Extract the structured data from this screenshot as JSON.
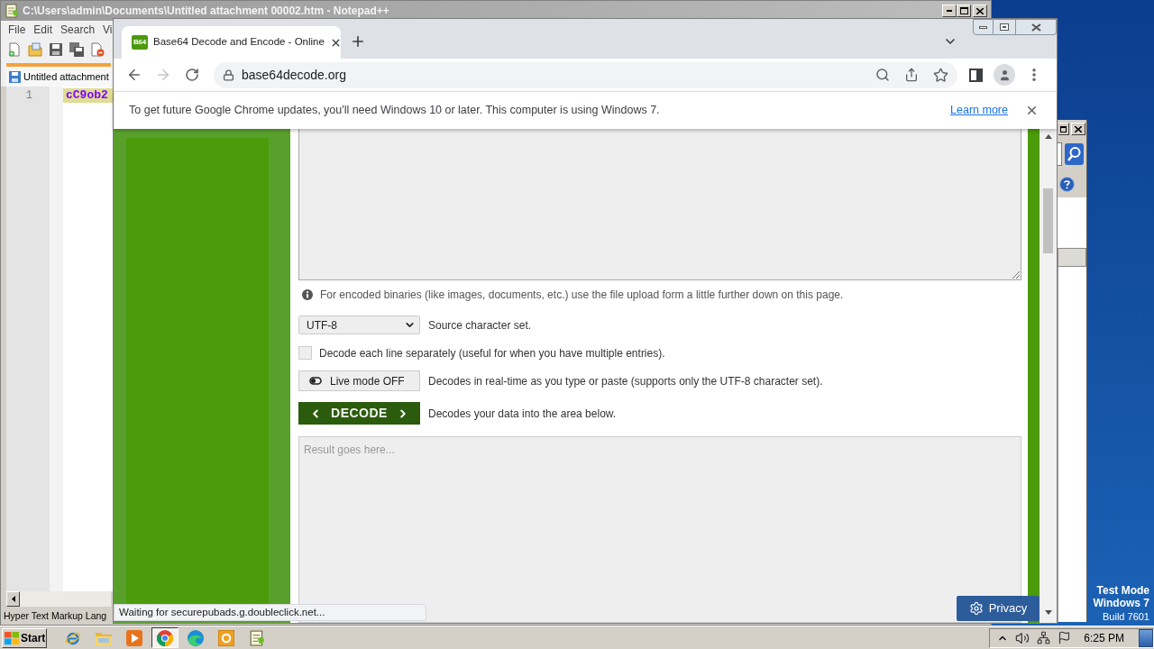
{
  "notepad": {
    "title": "C:\\Users\\admin\\Documents\\Untitled attachment 00002.htm - Notepad++",
    "menu": [
      "File",
      "Edit",
      "Search",
      "Vi"
    ],
    "tab": "Untitled attachment",
    "lines": [
      {
        "number": "1",
        "code": "cC9ob2"
      }
    ],
    "status_bar": "Hyper Text Markup Lang"
  },
  "browser": {
    "tabs": [
      {
        "favicon": "B64",
        "title": "Base64 Decode and Encode - Online",
        "selected": true
      }
    ],
    "forward_disabled": true,
    "address": "base64decode.org",
    "infobar": {
      "message": "To get future Google Chrome updates, you'll need Windows 10 or later. This computer is using Windows 7.",
      "link": "Learn more"
    },
    "status": "Waiting for securepubads.g.doubleclick.net..."
  },
  "page": {
    "note": "For encoded binaries (like images, documents, etc.) use the file upload form a little further down on this page.",
    "options": [
      {
        "kind": "select",
        "value": "UTF-8",
        "description": "Source character set."
      },
      {
        "kind": "checkbox",
        "checked": false,
        "description": "Decode each line separately (useful for when you have multiple entries)."
      },
      {
        "kind": "toggle",
        "on": false,
        "button": "Live mode OFF",
        "description": "Decodes in real-time as you type or paste (supports only the UTF-8 character set)."
      },
      {
        "kind": "action",
        "button": "DECODE",
        "description": "Decodes your data into the area below."
      }
    ],
    "result": {
      "placeholder": "Result goes here..."
    },
    "privacy_button": "Privacy"
  },
  "desktop": {
    "notice": [
      "Test Mode",
      "Windows 7",
      "Build 7601"
    ]
  },
  "taskbar": {
    "start": "Start",
    "apps": [
      {
        "kind": "ie",
        "selected": false
      },
      {
        "kind": "folder",
        "selected": false
      },
      {
        "kind": "player",
        "selected": false
      },
      {
        "kind": "chrome",
        "selected": true
      },
      {
        "kind": "edge",
        "selected": false
      },
      {
        "kind": "mail",
        "selected": false
      },
      {
        "kind": "editor",
        "selected": false
      }
    ],
    "clock": "6:25 PM"
  }
}
